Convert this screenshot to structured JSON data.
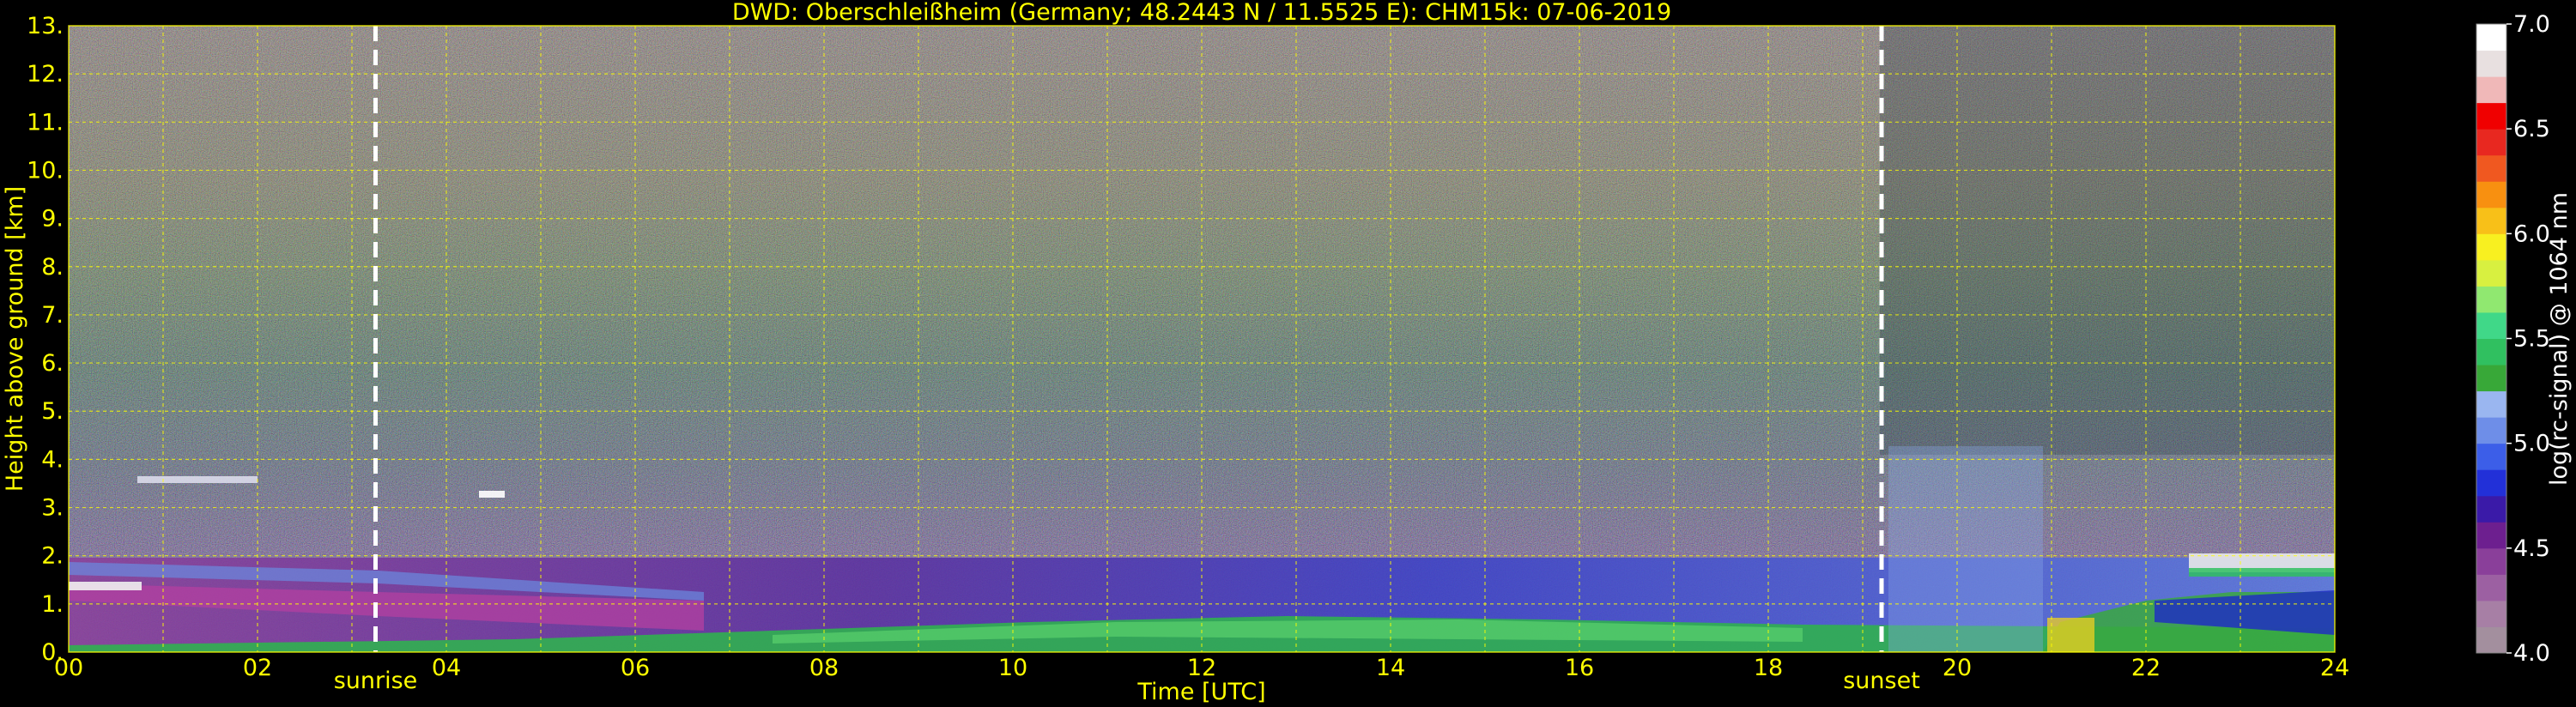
{
  "chart_data": {
    "type": "heatmap",
    "title": "DWD: Oberschleißheim (Germany; 48.2443 N / 11.5525 E):    CHM15k: 07-06-2019",
    "xlabel": "Time [UTC]",
    "ylabel": "Height above ground [km]",
    "xlim": [
      0,
      24
    ],
    "ylim": [
      0,
      13
    ],
    "x_ticks": [
      "00",
      "02",
      "04",
      "06",
      "08",
      "10",
      "12",
      "14",
      "16",
      "18",
      "20",
      "22",
      "24"
    ],
    "y_ticks": [
      "0.",
      "1.",
      "2.",
      "3.",
      "4.",
      "5.",
      "6.",
      "7.",
      "8.",
      "9.",
      "10.",
      "11.",
      "12.",
      "13."
    ],
    "grid": true,
    "annotations": [
      {
        "label": "sunrise",
        "x": 3.25
      },
      {
        "label": "sunset",
        "x": 19.2
      }
    ],
    "colorbar": {
      "label": "log(rc-signal) @ 1064 nm",
      "range": [
        4.0,
        7.0
      ],
      "ticks": [
        "4.0",
        "4.5",
        "5.0",
        "5.5",
        "6.0",
        "6.5",
        "7.0"
      ],
      "colors": [
        "#a38f9e",
        "#a77fa5",
        "#9c60a2",
        "#8a3f9a",
        "#6d1f8f",
        "#3a1aa8",
        "#2230d8",
        "#3c5ee8",
        "#6e8ee8",
        "#9ab6f0",
        "#38a838",
        "#30c060",
        "#40d888",
        "#90e870",
        "#d8f040",
        "#f8f020",
        "#f8c018",
        "#f89010",
        "#f05820",
        "#e82820",
        "#f00000",
        "#f0b8b8",
        "#e8e0e0",
        "#ffffff"
      ]
    },
    "features": [
      {
        "kind": "boundary-layer-aerosol",
        "x_range": [
          0,
          24
        ],
        "height_km": [
          0,
          1.0
        ]
      },
      {
        "kind": "residual-layer",
        "x_range": [
          0,
          6.5
        ],
        "height_km": [
          0.3,
          1.0
        ]
      },
      {
        "kind": "elevated-aerosol-layer",
        "x_range": [
          0.7,
          2.0
        ],
        "height_km": [
          3.2,
          3.6
        ]
      },
      {
        "kind": "cloud",
        "x_range": [
          4.4,
          4.6
        ],
        "height_km": [
          3.0,
          3.2
        ]
      },
      {
        "kind": "low-cloud",
        "x_range": [
          22.5,
          24
        ],
        "height_km": [
          1.6,
          2.0
        ]
      }
    ]
  }
}
